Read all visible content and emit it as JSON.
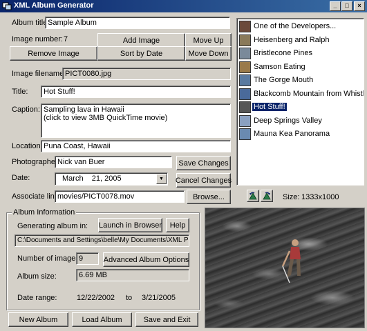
{
  "window": {
    "title": "XML Album Generator"
  },
  "fields": {
    "album_title_label": "Album title:",
    "album_title_value": "Sample Album",
    "image_number_label": "Image number:",
    "image_number_value": "7",
    "image_filename_label": "Image filename:",
    "image_filename_value": "PICT0080.jpg",
    "title_label": "Title:",
    "title_value": "Hot Stuff!",
    "caption_label": "Caption:",
    "caption_value": "Sampling lava in Hawaii\n(click to view 3MB QuickTime movie)",
    "location_label": "Location:",
    "location_value": "Puna Coast, Hawaii",
    "photographer_label": "Photographer:",
    "photographer_value": "Nick van Buer",
    "date_label": "Date:",
    "date_value": "March    21, 2005",
    "associate_link_label": "Associate link:",
    "associate_link_value": "movies/PICT0078.mov"
  },
  "buttons": {
    "add_image": "Add Image",
    "move_up": "Move Up",
    "remove_image": "Remove Image",
    "sort_by_date": "Sort by Date",
    "move_down": "Move Down",
    "save_changes": "Save Changes",
    "cancel_changes": "Cancel Changes",
    "browse": "Browse...",
    "launch_in_browser": "Launch in Browser",
    "help": "Help",
    "advanced_album_options": "Advanced Album Options",
    "new_album": "New Album",
    "load_album": "Load Album",
    "save_and_exit": "Save and Exit"
  },
  "image_list": [
    {
      "label": "One of the Developers...",
      "thumb": "#6b4a3a",
      "selected": false
    },
    {
      "label": "Heisenberg and Ralph",
      "thumb": "#8a7a5a",
      "selected": false
    },
    {
      "label": "Bristlecone Pines",
      "thumb": "#7a8a9a",
      "selected": false
    },
    {
      "label": "Samson Eating",
      "thumb": "#9a7a4a",
      "selected": false
    },
    {
      "label": "The Gorge Mouth",
      "thumb": "#5a7aa0",
      "selected": false
    },
    {
      "label": "Blackcomb Mountain from Whistler ...",
      "thumb": "#4a6a9a",
      "selected": false
    },
    {
      "label": "Hot Stuff!",
      "thumb": "#555555",
      "selected": true
    },
    {
      "label": "Deep Springs Valley",
      "thumb": "#8aa0c0",
      "selected": false
    },
    {
      "label": "Mauna Kea Panorama",
      "thumb": "#6a8ab0",
      "selected": false
    }
  ],
  "preview": {
    "size_label": "Size:",
    "size_value": "1333x1000",
    "rotate_left_icon": "rotate-left-icon",
    "rotate_right_icon": "rotate-right-icon"
  },
  "album_info": {
    "group_title": "Album Information",
    "generating_label": "Generating album in:",
    "path_value": "C:\\Documents and Settings\\belle\\My Documents\\XML Photo Alb",
    "num_images_label": "Number of images:",
    "num_images_value": "9",
    "album_size_label": "Album size:",
    "album_size_value": "6.69 MB",
    "date_range_label": "Date range:",
    "date_range_start": "12/22/2002",
    "date_range_to": "to",
    "date_range_end": "3/21/2005"
  },
  "colors": {
    "titlebar": "#0a246a",
    "selection": "#0a246a",
    "face": "#d4d0c8"
  }
}
